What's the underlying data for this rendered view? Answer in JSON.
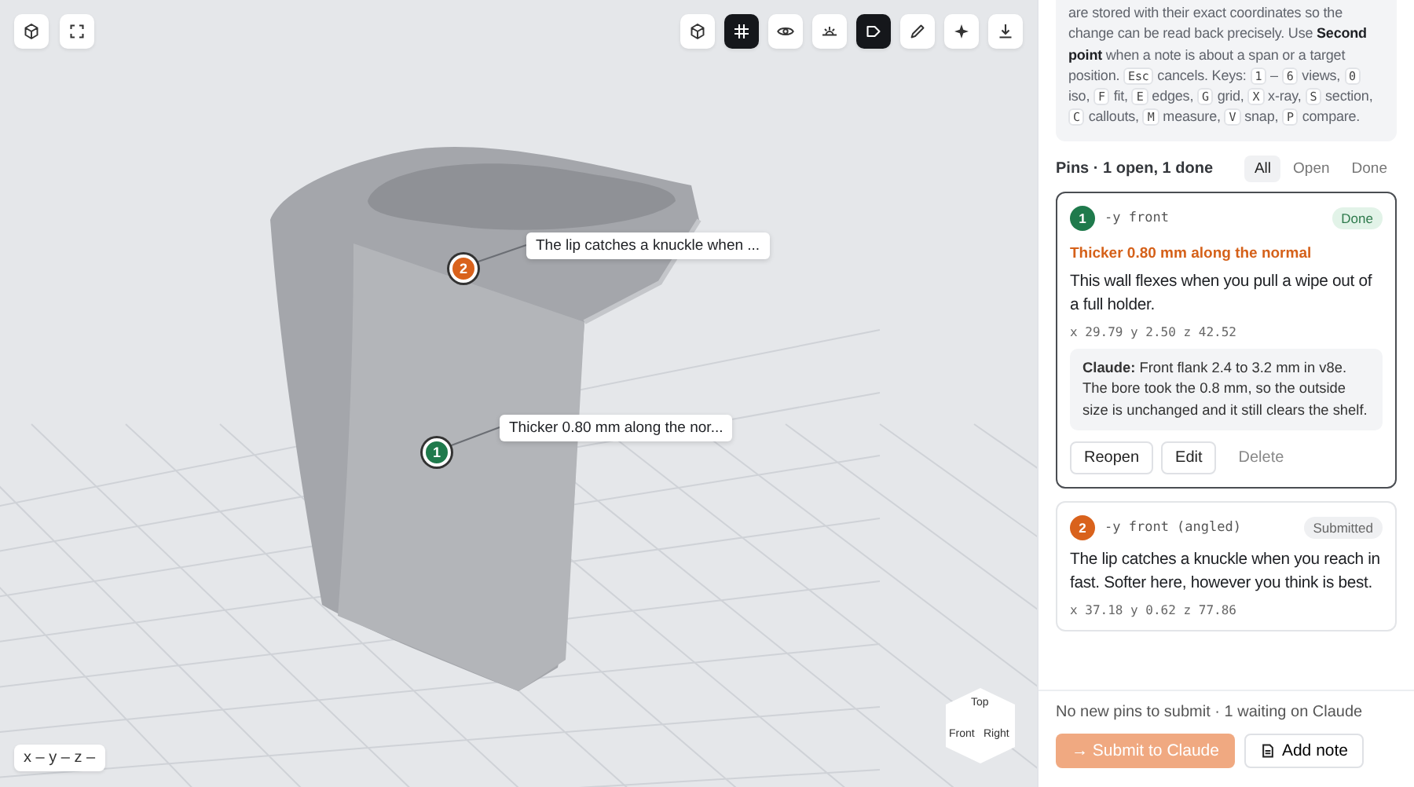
{
  "viewport": {
    "corner_buttons": [
      {
        "kind": "cube"
      },
      {
        "kind": "fullscreen"
      }
    ],
    "toolbar": [
      {
        "kind": "cube",
        "on": false
      },
      {
        "kind": "grid",
        "on": true
      },
      {
        "kind": "eye",
        "on": false
      },
      {
        "kind": "horizon",
        "on": false
      },
      {
        "kind": "tag",
        "on": true
      },
      {
        "kind": "pencil",
        "on": false
      },
      {
        "kind": "sparkle",
        "on": false
      },
      {
        "kind": "download",
        "on": false
      }
    ],
    "pins": [
      {
        "number": "2",
        "color": "#d9621c",
        "callout": "The lip catches a knuckle when ..."
      },
      {
        "number": "1",
        "color": "#1f7a4c",
        "callout": "Thicker 0.80 mm along the nor..."
      }
    ],
    "view_cube": {
      "top": "Top",
      "front": "Front",
      "right": "Right"
    },
    "coordinates": "x – y – z –"
  },
  "sidebar": {
    "help": [
      {
        "kind": "text",
        "text": "are stored with their exact coordinates so the change can be read back precisely. Use "
      },
      {
        "kind": "bold",
        "text": "Second point"
      },
      {
        "kind": "text",
        "text": " when a note is about a span or a target position. "
      },
      {
        "kind": "key",
        "text": "Esc"
      },
      {
        "kind": "text",
        "text": " cancels. Keys: "
      },
      {
        "kind": "key",
        "text": "1"
      },
      {
        "kind": "text",
        "text": " – "
      },
      {
        "kind": "key",
        "text": "6"
      },
      {
        "kind": "text",
        "text": " views, "
      },
      {
        "kind": "key",
        "text": "0"
      },
      {
        "kind": "text",
        "text": " iso, "
      },
      {
        "kind": "key",
        "text": "F"
      },
      {
        "kind": "text",
        "text": " fit, "
      },
      {
        "kind": "key",
        "text": "E"
      },
      {
        "kind": "text",
        "text": " edges, "
      },
      {
        "kind": "key",
        "text": "G"
      },
      {
        "kind": "text",
        "text": " grid, "
      },
      {
        "kind": "key",
        "text": "X"
      },
      {
        "kind": "text",
        "text": " x-ray, "
      },
      {
        "kind": "key",
        "text": "S"
      },
      {
        "kind": "text",
        "text": " section, "
      },
      {
        "kind": "key",
        "text": "C"
      },
      {
        "kind": "text",
        "text": " callouts, "
      },
      {
        "kind": "key",
        "text": "M"
      },
      {
        "kind": "text",
        "text": " measure, "
      },
      {
        "kind": "key",
        "text": "V"
      },
      {
        "kind": "text",
        "text": " snap, "
      },
      {
        "kind": "key",
        "text": "P"
      },
      {
        "kind": "text",
        "text": " compare."
      }
    ],
    "pins_heading": "Pins · 1 open, 1 done",
    "filters": [
      {
        "label": "All",
        "selected": true
      },
      {
        "label": "Open",
        "selected": false
      },
      {
        "label": "Done",
        "selected": false
      }
    ],
    "cards": [
      {
        "number": "1",
        "color": "#1f7a4c",
        "view": "-y front",
        "status": "Done",
        "kind": "done",
        "selected": true,
        "title": "Thicker 0.80 mm along the normal",
        "note": "This wall flexes when you pull a wipe out of a full holder.",
        "coords": "x 29.79  y 2.50  z 42.52",
        "reply": "**Claude:** Front flank 2.4 to 3.2 mm in v8e. The bore took the 0.8 mm, so the outside size is unchanged and it still clears the shelf.",
        "actions": [
          "Reopen",
          "Edit",
          "Delete"
        ]
      },
      {
        "number": "2",
        "color": "#d9621c",
        "view": "-y front (angled)",
        "status": "Submitted",
        "kind": "submitted",
        "selected": false,
        "note": "The lip catches a knuckle when you reach in fast. Softer here, however you think is best.",
        "coords": "x 37.18  y 0.62  z 77.86"
      }
    ],
    "footer_status": "No new pins to submit · 1 waiting on Claude",
    "submit": {
      "label": "→ Submit to Claude",
      "disabled": true
    },
    "add_note": "Add note"
  }
}
